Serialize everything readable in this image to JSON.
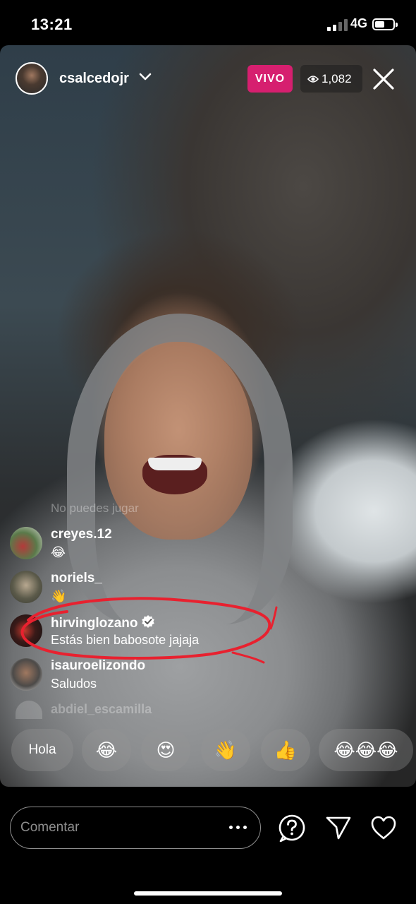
{
  "status_bar": {
    "time": "13:21",
    "network": "4G"
  },
  "header": {
    "username": "csalcedojr",
    "live_label": "VIVO",
    "viewer_count": "1,082"
  },
  "comments": {
    "faded_system_message": "No puedes jugar",
    "items": [
      {
        "username": "creyes.12",
        "text": "😂"
      },
      {
        "username": "noriels_",
        "text": "👋"
      },
      {
        "username": "hirvinglozano",
        "text": "Estás bien babosote jajaja",
        "verified": true
      },
      {
        "username": "isauroelizondo",
        "text": "Saludos"
      }
    ],
    "faded_username": "abdiel_escamilla"
  },
  "quick_reactions": [
    "Hola",
    "😂",
    "😍",
    "👋",
    "👍",
    "😂😂😂"
  ],
  "bottom_bar": {
    "comment_placeholder": "Comentar"
  },
  "colors": {
    "live_badge": "#d61f6f",
    "annotation": "#e8212f",
    "verified": "#ffffff"
  },
  "icons": [
    "eye-icon",
    "chevron-down-icon",
    "close-icon",
    "verified-icon",
    "more-icon",
    "question-icon",
    "send-icon",
    "heart-icon"
  ]
}
